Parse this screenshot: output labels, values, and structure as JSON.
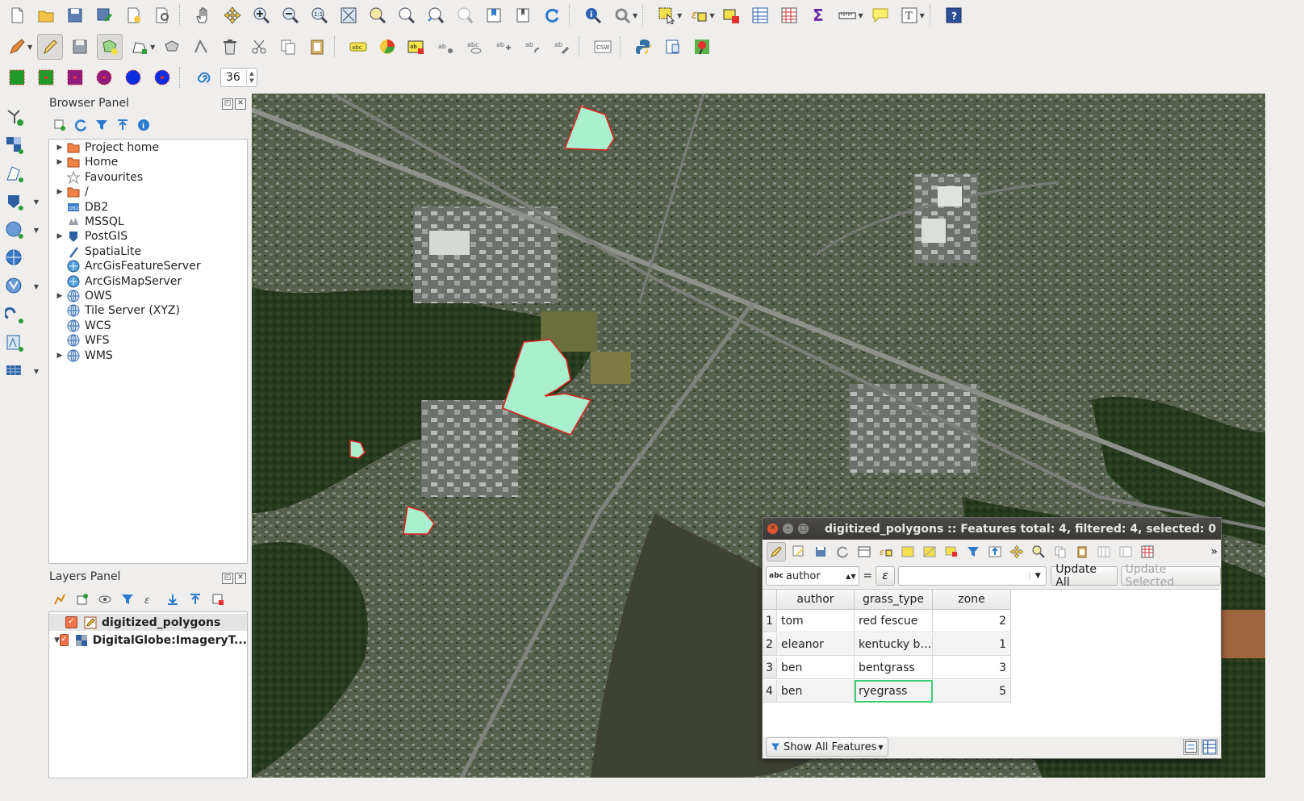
{
  "toolbar_spin_value": "36",
  "browser_panel": {
    "title": "Browser Panel",
    "items": [
      {
        "label": "Project home",
        "icon": "folder-icon",
        "expandable": true
      },
      {
        "label": "Home",
        "icon": "folder-icon",
        "expandable": true
      },
      {
        "label": "Favourites",
        "icon": "star-icon",
        "expandable": false
      },
      {
        "label": "/",
        "icon": "folder-icon",
        "expandable": true
      },
      {
        "label": "DB2",
        "icon": "db2-icon",
        "expandable": false
      },
      {
        "label": "MSSQL",
        "icon": "mssql-icon",
        "expandable": false
      },
      {
        "label": "PostGIS",
        "icon": "postgis-icon",
        "expandable": true
      },
      {
        "label": "SpatiaLite",
        "icon": "spatialite-icon",
        "expandable": false
      },
      {
        "label": "ArcGisFeatureServer",
        "icon": "arcgis-icon",
        "expandable": false
      },
      {
        "label": "ArcGisMapServer",
        "icon": "arcgis-icon",
        "expandable": false
      },
      {
        "label": "OWS",
        "icon": "globe-icon",
        "expandable": true
      },
      {
        "label": "Tile Server (XYZ)",
        "icon": "globe-icon",
        "expandable": false
      },
      {
        "label": "WCS",
        "icon": "globe-icon",
        "expandable": false
      },
      {
        "label": "WFS",
        "icon": "globe-icon",
        "expandable": false
      },
      {
        "label": "WMS",
        "icon": "globe-icon",
        "expandable": true
      }
    ]
  },
  "layers_panel": {
    "title": "Layers Panel",
    "layers": [
      {
        "name": "digitized_polygons",
        "checked": true
      },
      {
        "name": "DigitalGlobe:ImageryT...",
        "checked": true
      }
    ]
  },
  "attribute_table": {
    "title": "digitized_polygons :: Features total: 4, filtered: 4, selected: 0",
    "field_combo": "author",
    "field_type_tag": "abc",
    "equals": "=",
    "expression_symbol": "ε",
    "update_all": "Update All",
    "update_selected": "Update Selected",
    "columns": [
      "author",
      "grass_type",
      "zone"
    ],
    "rows": [
      {
        "num": "1",
        "author": "tom",
        "grass_type": "red fescue",
        "zone": "2"
      },
      {
        "num": "2",
        "author": "eleanor",
        "grass_type": "kentucky b…",
        "zone": "1"
      },
      {
        "num": "3",
        "author": "ben",
        "grass_type": "bentgrass",
        "zone": "3"
      },
      {
        "num": "4",
        "author": "ben",
        "grass_type": "ryegrass",
        "zone": "5"
      }
    ],
    "show_all_features": "Show All Features"
  },
  "colors": {
    "polygon_fill": "#a9f0cf",
    "vertex_marker": "#e02020",
    "titlebar_bg": "#3f3e3a"
  }
}
